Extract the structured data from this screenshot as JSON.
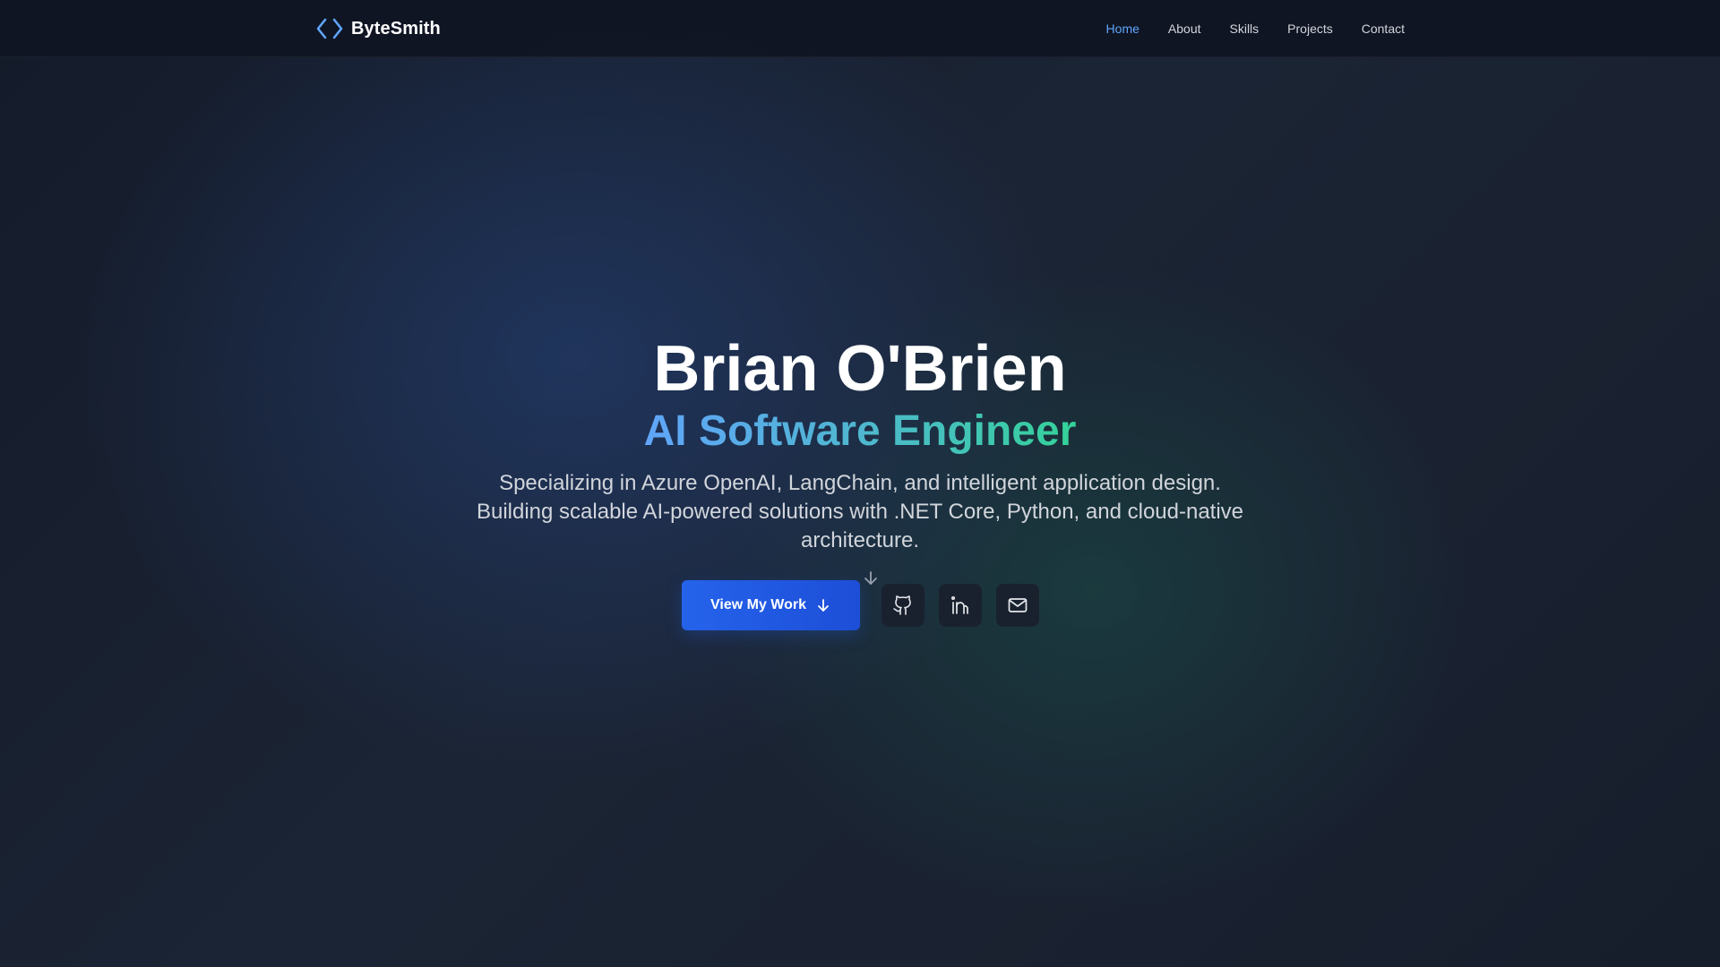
{
  "brand": {
    "name": "ByteSmith",
    "icon": "code-brackets-icon"
  },
  "nav": {
    "items": [
      {
        "label": "Home",
        "active": true
      },
      {
        "label": "About",
        "active": false
      },
      {
        "label": "Skills",
        "active": false
      },
      {
        "label": "Projects",
        "active": false
      },
      {
        "label": "Contact",
        "active": false
      }
    ]
  },
  "hero": {
    "name": "Brian O'Brien",
    "role": "AI Software Engineer",
    "description": "Specializing in Azure OpenAI, LangChain, and intelligent application design. Building scalable AI-powered solutions with .NET Core, Python, and cloud-native architecture.",
    "cta_label": "View My Work",
    "cta_icon": "arrow-down-icon",
    "scroll_icon": "arrow-down-icon",
    "social": [
      {
        "name": "github",
        "icon": "github-icon"
      },
      {
        "name": "linkedin",
        "icon": "linkedin-icon"
      },
      {
        "name": "email",
        "icon": "mail-icon"
      }
    ]
  },
  "colors": {
    "accent": "#60a5fa",
    "primary_button": "#2563eb",
    "gradient_start": "#60a5fa",
    "gradient_end": "#34d399",
    "background": "#172030"
  }
}
